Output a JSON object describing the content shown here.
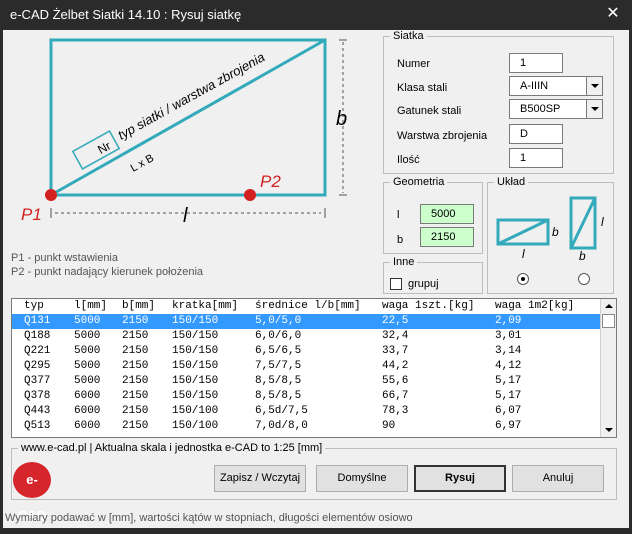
{
  "window": {
    "title": "e-CAD Żelbet Siatki 14.10 : Rysuj siatkę",
    "close_glyph": "✕"
  },
  "diagram": {
    "label_diagonal": "typ siatki / warstwa zbrojenia",
    "label_lxb": "L x B",
    "label_nr": "Nr",
    "label_b": "b",
    "label_l": "l",
    "label_p1": "P1",
    "label_p2": "P2",
    "accent_color": "#33aabb",
    "point_color": "#d32020"
  },
  "legend_text": {
    "p1": "P1 - punkt wstawienia",
    "p2": "P2 - punkt nadający kierunek położenia"
  },
  "siatka": {
    "title": "Siatka",
    "numer_label": "Numer",
    "numer_value": "1",
    "klasa_label": "Klasa stali",
    "klasa_value": "A-IIIN",
    "gatunek_label": "Gatunek stali",
    "gatunek_value": "B500SP",
    "warstwa_label": "Warstwa zbrojenia",
    "warstwa_value": "D",
    "ilosc_label": "Ilość",
    "ilosc_value": "1"
  },
  "geometria": {
    "title": "Geometria",
    "l_label": "l",
    "l_value": "5000",
    "b_label": "b",
    "b_value": "2150"
  },
  "uklad": {
    "title": "Układ",
    "opt1_b": "b",
    "opt1_l": "l",
    "opt2_l": "l",
    "opt2_b": "b"
  },
  "inne": {
    "title": "Inne",
    "grupuj_label": "grupuj"
  },
  "table": {
    "headers": [
      "typ",
      "l[mm]",
      "b[mm]",
      "kratka[mm]",
      "średnice l/b[mm]",
      "waga 1szt.[kg]",
      "waga 1m2[kg]"
    ],
    "rows": [
      [
        "Q131",
        "5000",
        "2150",
        "150/150",
        "5,0/5,0",
        "22,5",
        "2,09"
      ],
      [
        "Q188",
        "5000",
        "2150",
        "150/150",
        "6,0/6,0",
        "32,4",
        "3,01"
      ],
      [
        "Q221",
        "5000",
        "2150",
        "150/150",
        "6,5/6,5",
        "33,7",
        "3,14"
      ],
      [
        "Q295",
        "5000",
        "2150",
        "150/150",
        "7,5/7,5",
        "44,2",
        "4,12"
      ],
      [
        "Q377",
        "5000",
        "2150",
        "150/150",
        "8,5/8,5",
        "55,6",
        "5,17"
      ],
      [
        "Q378",
        "6000",
        "2150",
        "150/150",
        "8,5/8,5",
        "66,7",
        "5,17"
      ],
      [
        "Q443",
        "6000",
        "2150",
        "150/100",
        "6,5d/7,5",
        "78,3",
        "6,07"
      ],
      [
        "Q513",
        "6000",
        "2150",
        "150/100",
        "7,0d/8,0",
        "90",
        "6,97"
      ]
    ]
  },
  "footer": {
    "info": "www.e-cad.pl | Aktualna skala i jednostka e-CAD to 1:25 [mm]",
    "logo_text": "e-CAD",
    "btn_save": "Zapisz / Wczytaj",
    "btn_default": "Domyślne",
    "btn_draw": "Rysuj",
    "btn_cancel": "Anuluj",
    "status": "Wymiary podawać w [mm], wartości kątów w stopniach, długości elementów osiowo"
  }
}
